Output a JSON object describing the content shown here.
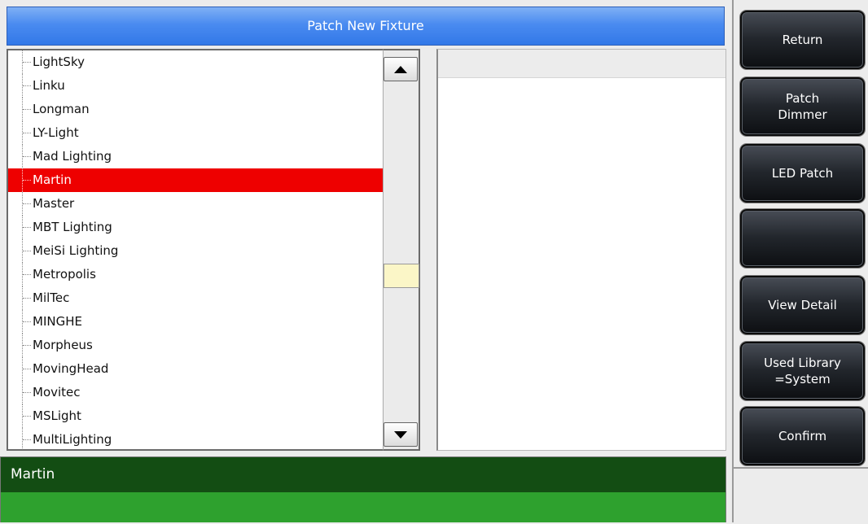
{
  "window": {
    "title": "Patch New Fixture"
  },
  "manufacturer_list": {
    "items": [
      "LightSky",
      "Linku",
      "Longman",
      "LY-Light",
      "Mad Lighting",
      "Martin",
      "Master",
      "MBT Lighting",
      "MeiSi Lighting",
      "Metropolis",
      "MilTec",
      "MINGHE",
      "Morpheus",
      "MovingHead",
      "Movitec",
      "MSLight",
      "MultiLighting"
    ],
    "selected": "Martin"
  },
  "scrollbar": {
    "up_icon": "triangle-up-icon",
    "down_icon": "triangle-down-icon"
  },
  "status": {
    "selected_text": "Martin"
  },
  "side_buttons": {
    "return": "Return",
    "patch_dimmer": "Patch\nDimmer",
    "led_patch": "LED Patch",
    "blank": "",
    "view_detail": "View Detail",
    "used_library": "Used Library\n=System",
    "confirm": "Confirm"
  },
  "colors": {
    "title_bar": "#4a8bf0",
    "selection": "#ee0000",
    "status_dark": "#134d13",
    "status_light": "#2ea12e",
    "scroll_thumb": "#fbf6c7"
  }
}
